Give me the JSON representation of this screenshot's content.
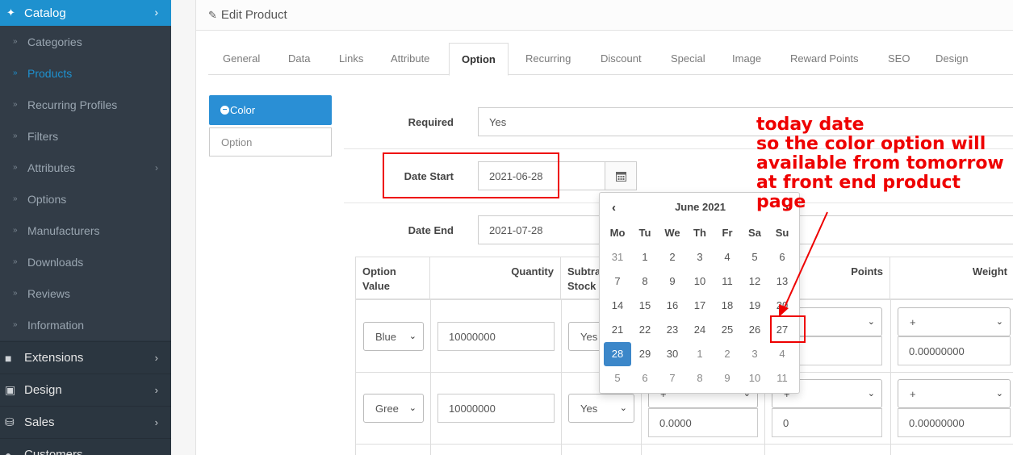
{
  "sidebar": {
    "catalog": "Catalog",
    "items": [
      "Categories",
      "Products",
      "Recurring Profiles",
      "Filters",
      "Attributes",
      "Options",
      "Manufacturers",
      "Downloads",
      "Reviews",
      "Information"
    ],
    "main": [
      "Extensions",
      "Design",
      "Sales",
      "Customers"
    ]
  },
  "header": {
    "title": "Edit Product"
  },
  "tabs": [
    "General",
    "Data",
    "Links",
    "Attribute",
    "Option",
    "Recurring",
    "Discount",
    "Special",
    "Image",
    "Reward Points",
    "SEO",
    "Design"
  ],
  "options": {
    "active": "Color",
    "other": "Option"
  },
  "form": {
    "required_label": "Required",
    "required_value": "Yes",
    "date_start_label": "Date Start",
    "date_start_value": "2021-06-28",
    "date_end_label": "Date End",
    "date_end_value": "2021-07-28"
  },
  "table": {
    "headers": [
      "Option Value",
      "Quantity",
      "Subtract Stock",
      "Points",
      "Weight"
    ],
    "header_visible": {
      "option_value": "Option\nValue",
      "subtract": "Subtra\nStock"
    },
    "rows": [
      {
        "value": "Blue",
        "quantity": "10000000",
        "subtract": "Yes",
        "weight_prefix": "+",
        "weight": "0.00000000"
      },
      {
        "value": "Green",
        "value_visible": "Gree",
        "quantity": "10000000",
        "subtract": "Yes",
        "price_prefix": "+",
        "price": "0.0000",
        "points_prefix": "+",
        "points": "0",
        "weight_prefix": "+",
        "weight": "0.00000000"
      }
    ]
  },
  "calendar": {
    "title": "June 2021",
    "prev": "‹",
    "next": "›",
    "days_of_week": [
      "Mo",
      "Tu",
      "We",
      "Th",
      "Fr",
      "Sa",
      "Su"
    ],
    "weeks": [
      [
        "31",
        "1",
        "2",
        "3",
        "4",
        "5",
        "6"
      ],
      [
        "7",
        "8",
        "9",
        "10",
        "11",
        "12",
        "13"
      ],
      [
        "14",
        "15",
        "16",
        "17",
        "18",
        "19",
        "20"
      ],
      [
        "21",
        "22",
        "23",
        "24",
        "25",
        "26",
        "27"
      ],
      [
        "28",
        "29",
        "30",
        "1",
        "2",
        "3",
        "4"
      ],
      [
        "5",
        "6",
        "7",
        "8",
        "9",
        "10",
        "11"
      ]
    ],
    "selected": "28"
  },
  "annotation": {
    "lines": [
      "today date",
      "so the color option will",
      "available from tomorrow",
      "at front end product page"
    ],
    "color": "#e00000"
  }
}
